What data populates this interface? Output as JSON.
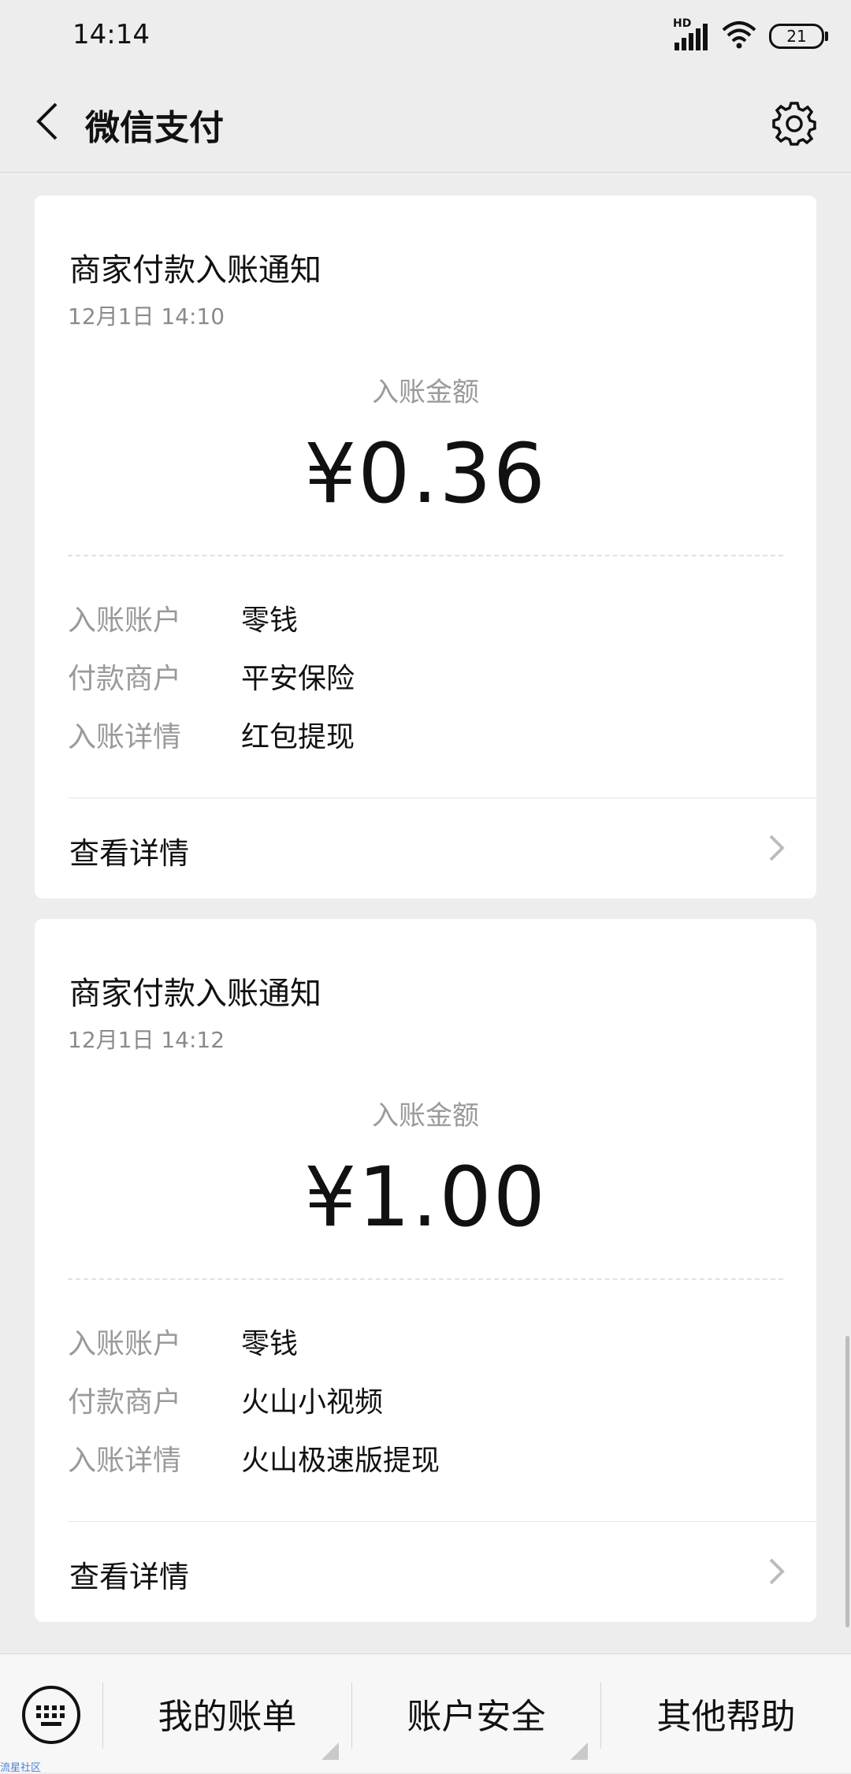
{
  "status_bar": {
    "time": "14:14",
    "network_label": "HD",
    "battery": "21"
  },
  "header": {
    "title": "微信支付"
  },
  "cards": [
    {
      "title": "商家付款入账通知",
      "date": "12月1日  14:10",
      "amount_label": "入账金额",
      "amount": "¥0.36",
      "rows": [
        {
          "key": "入账账户",
          "value": "零钱"
        },
        {
          "key": "付款商户",
          "value": "平安保险"
        },
        {
          "key": "入账详情",
          "value": "红包提现"
        }
      ],
      "link_label": "查看详情"
    },
    {
      "title": "商家付款入账通知",
      "date": "12月1日  14:12",
      "amount_label": "入账金额",
      "amount": "¥1.00",
      "rows": [
        {
          "key": "入账账户",
          "value": "零钱"
        },
        {
          "key": "付款商户",
          "value": "火山小视频"
        },
        {
          "key": "入账详情",
          "value": "火山极速版提现"
        }
      ],
      "link_label": "查看详情"
    }
  ],
  "bottom_menu": {
    "items": [
      {
        "label": "我的账单"
      },
      {
        "label": "账户安全"
      },
      {
        "label": "其他帮助"
      }
    ]
  },
  "watermark": "流星社区",
  "icons": {
    "back": "back-arrow-icon",
    "settings": "gear-icon",
    "chevron": "chevron-right-icon",
    "keyboard": "keyboard-icon",
    "signal": "signal-icon",
    "wifi": "wifi-icon",
    "battery": "battery-icon"
  },
  "colors": {
    "background": "#ededed",
    "card": "#ffffff",
    "secondary_text": "#9a9a9a",
    "primary_text": "#111111"
  }
}
